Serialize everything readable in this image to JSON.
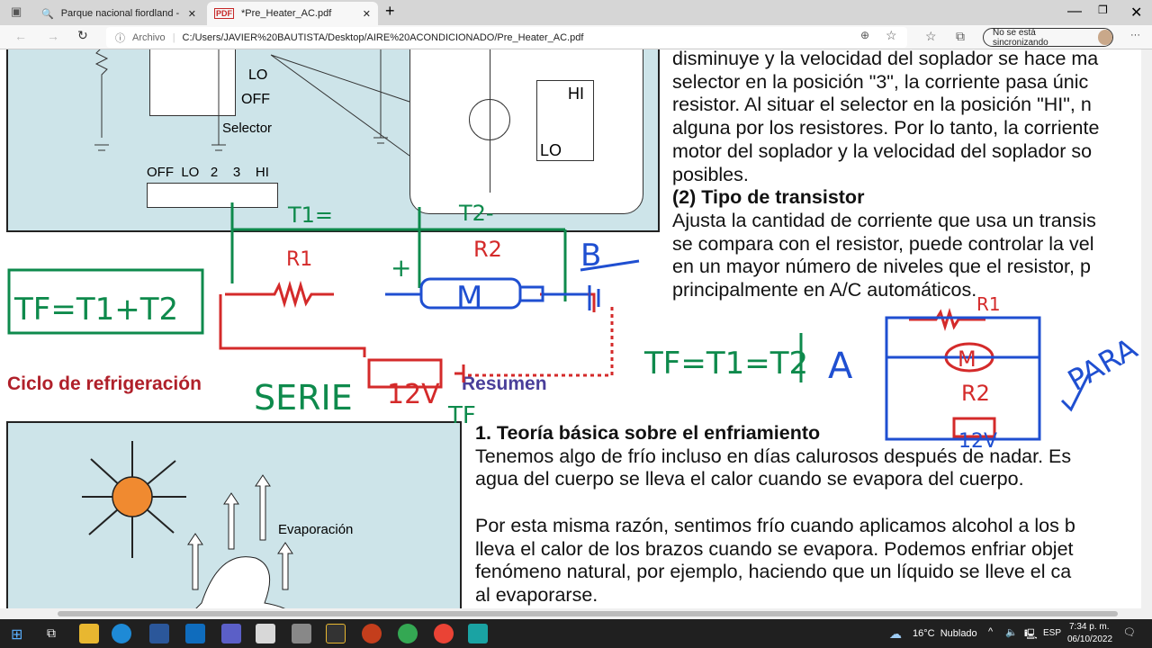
{
  "browser": {
    "tabs": [
      {
        "title": "Parque nacional fiordland - Busca",
        "icon": "search-icon"
      },
      {
        "title": "*Pre_Heater_AC.pdf",
        "icon": "pdf-icon"
      }
    ],
    "address_label": "Archivo",
    "url": "C:/Users/JAVIER%20BAUTISTA/Desktop/AIRE%20ACONDICIONADO/Pre_Heater_AC.pdf",
    "sync_label": "No se está sincronizando"
  },
  "pdf": {
    "figure1_labels": {
      "lo": "LO",
      "off": "OFF",
      "selector": "Selector",
      "scale": "OFF  LO   2    3    HI",
      "hi": "HI",
      "lo2": "LO",
      "m": "M"
    },
    "right_paragraph": [
      "disminuye y la velocidad del soplador se hace ma",
      "selector en la posición \"3\", la corriente pasa únic",
      "resistor. Al situar el selector en la posición \"HI\", n",
      "alguna por los resistores. Por lo tanto, la corriente",
      "motor del soplador y la velocidad del soplador so",
      "posibles."
    ],
    "heading2": "(2) Tipo de transistor",
    "right_paragraph2": [
      "Ajusta la cantidad de corriente que usa un transis",
      "se compara con el resistor, puede controlar la vel",
      "en un mayor número de niveles que el resistor, p",
      "principalmente en A/C automáticos."
    ],
    "section_left": "Ciclo de refrigeración",
    "section_right": "Resumen",
    "heading1": "1. Teoría básica sobre el enfriamiento",
    "body": [
      "Tenemos algo de frío incluso en días calurosos después de nadar. Es",
      "agua del cuerpo se lleva el calor cuando se evapora del cuerpo.",
      "",
      "Por esta misma razón, sentimos frío cuando aplicamos alcohol a los b",
      "lleva el calor de los brazos cuando se evapora. Podemos enfriar objet",
      "fenómeno natural, por ejemplo, haciendo que un líquido se lleve el ca",
      "al evaporarse."
    ],
    "figure2_label": "Evaporación"
  },
  "annotations": {
    "t1": "T1=",
    "t2": "T2-",
    "r1": "R1",
    "r2": "R2",
    "m": "M",
    "b": "B",
    "formula_series": "TF=T1+T2",
    "serie": "SERIE",
    "v12": "12V",
    "tf": "TF",
    "formula_parallel": "TF=T1=T2",
    "a": "A",
    "para": "PARA",
    "r1b": "R1",
    "m2": "M",
    "r2b": "R2",
    "v12b": "12V",
    "plus": "+",
    "minus": "-"
  },
  "colors": {
    "green": "#0e8a4c",
    "red": "#d42a2a",
    "blue": "#1f4fd1",
    "title_red": "#b0202a",
    "resumen": "#4a3f9a"
  },
  "taskbar": {
    "weather": "16°C  Nublado",
    "lang": "ESP",
    "time": "7:34 p. m.",
    "date": "06/10/2022",
    "apps": [
      "windows",
      "task-view",
      "file-explorer",
      "edge",
      "word",
      "mail",
      "teams",
      "store",
      "paint",
      "app",
      "powerpoint",
      "chrome",
      "chrome-profile",
      "app2"
    ]
  }
}
